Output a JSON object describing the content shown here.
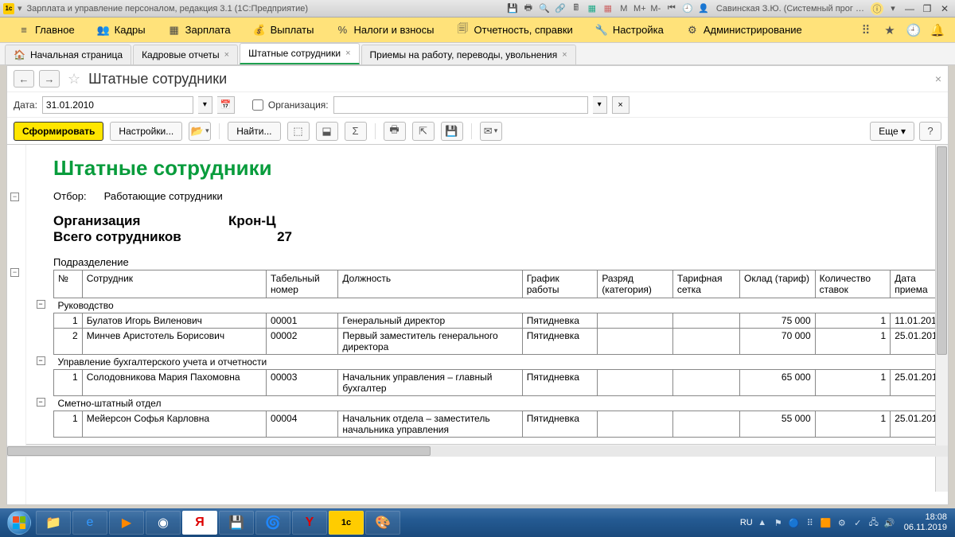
{
  "titlebar": {
    "app_badge": "1c",
    "title": "Зарплата и управление персоналом, редакция 3.1  (1С:Предприятие)",
    "user": "Савинская З.Ю. (Системный прог …",
    "m_labels": [
      "M",
      "M+",
      "M-"
    ]
  },
  "mainmenu": {
    "items": [
      {
        "icon": "≡",
        "label": "Главное"
      },
      {
        "icon": "👥",
        "label": "Кадры"
      },
      {
        "icon": "▦",
        "label": "Зарплата"
      },
      {
        "icon": "💰",
        "label": "Выплаты"
      },
      {
        "icon": "%",
        "label": "Налоги и взносы"
      },
      {
        "icon": "🗐",
        "label": "Отчетность, справки"
      },
      {
        "icon": "🔧",
        "label": "Настройка"
      },
      {
        "icon": "⚙",
        "label": "Администрирование"
      }
    ]
  },
  "tabs": [
    {
      "label": "Начальная страница",
      "home": true,
      "closable": false
    },
    {
      "label": "Кадровые отчеты",
      "closable": true
    },
    {
      "label": "Штатные сотрудники",
      "closable": true,
      "active": true
    },
    {
      "label": "Приемы на работу, переводы, увольнения",
      "closable": true
    }
  ],
  "page": {
    "title": "Штатные сотрудники",
    "date_label": "Дата:",
    "date_value": "31.01.2010",
    "org_label": "Организация:",
    "org_value": "",
    "btn_form": "Сформировать",
    "btn_settings": "Настройки...",
    "btn_find": "Найти...",
    "btn_more": "Еще",
    "btn_help": "?"
  },
  "report": {
    "title": "Штатные сотрудники",
    "filter_label": "Отбор:",
    "filter_value": "Работающие сотрудники",
    "org_label": "Организация",
    "org_value": "Крон-Ц",
    "total_label": "Всего сотрудников",
    "total_value": "27",
    "dept_label": "Подразделение",
    "columns": [
      "№",
      "Сотрудник",
      "Табельный номер",
      "Должность",
      "График работы",
      "Разряд (категория)",
      "Тарифная сетка",
      "Оклад (тариф)",
      "Количество ставок",
      "Дата приема"
    ],
    "groups": [
      {
        "name": "Руководство",
        "rows": [
          {
            "n": "1",
            "emp": "Булатов Игорь Виленович",
            "tab": "00001",
            "pos": "Генеральный директор",
            "sched": "Пятидневка",
            "cat": "",
            "grid": "",
            "salary": "75 000",
            "rate": "1",
            "hired": "11.01.201"
          },
          {
            "n": "2",
            "emp": "Минчев Аристотель Борисович",
            "tab": "00002",
            "pos": "Первый заместитель генерального директора",
            "sched": "Пятидневка",
            "cat": "",
            "grid": "",
            "salary": "70 000",
            "rate": "1",
            "hired": "25.01.201"
          }
        ]
      },
      {
        "name": "Управление бухгалтерского учета и отчетности",
        "rows": [
          {
            "n": "1",
            "emp": "Солодовникова Мария Пахомовна",
            "tab": "00003",
            "pos": "Начальник управления – главный бухгалтер",
            "sched": "Пятидневка",
            "cat": "",
            "grid": "",
            "salary": "65 000",
            "rate": "1",
            "hired": "25.01.201"
          }
        ]
      },
      {
        "name": "Сметно-штатный отдел",
        "rows": [
          {
            "n": "1",
            "emp": "Мейерсон Софья Карловна",
            "tab": "00004",
            "pos": "Начальник отдела – заместитель начальника управления",
            "sched": "Пятидневка",
            "cat": "",
            "grid": "",
            "salary": "55 000",
            "rate": "1",
            "hired": "25.01.201"
          }
        ]
      }
    ]
  },
  "taskbar": {
    "lang": "RU",
    "time": "18:08",
    "date": "06.11.2019"
  }
}
